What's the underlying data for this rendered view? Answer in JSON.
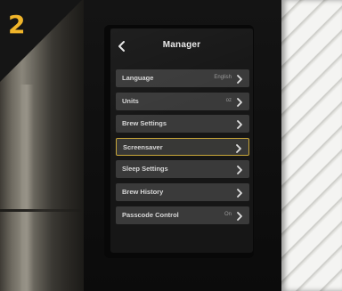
{
  "step": {
    "number": "2",
    "accent": "#f0b52a"
  },
  "header": {
    "back_icon": "chevron-left-icon",
    "title": "Manager"
  },
  "menu": {
    "items": [
      {
        "label": "Language",
        "value": "English",
        "icon": "chevron-right-icon",
        "selected": false
      },
      {
        "label": "Units",
        "value": "oz",
        "icon": "chevron-right-icon",
        "selected": false
      },
      {
        "label": "Brew Settings",
        "value": "",
        "icon": "chevron-right-icon",
        "selected": false
      },
      {
        "label": "Screensaver",
        "value": "",
        "icon": "chevron-right-icon",
        "selected": true
      },
      {
        "label": "Sleep Settings",
        "value": "",
        "icon": "chevron-right-icon",
        "selected": false
      },
      {
        "label": "Brew History",
        "value": "",
        "icon": "chevron-right-icon",
        "selected": false
      },
      {
        "label": "Passcode Control",
        "value": "On",
        "icon": "chevron-right-icon",
        "selected": false
      }
    ]
  },
  "colors": {
    "screen_bg": "#161616",
    "item_bg": "#3a3a3a",
    "selected_border": "#c9a73a",
    "text": "#d7d7d7"
  }
}
